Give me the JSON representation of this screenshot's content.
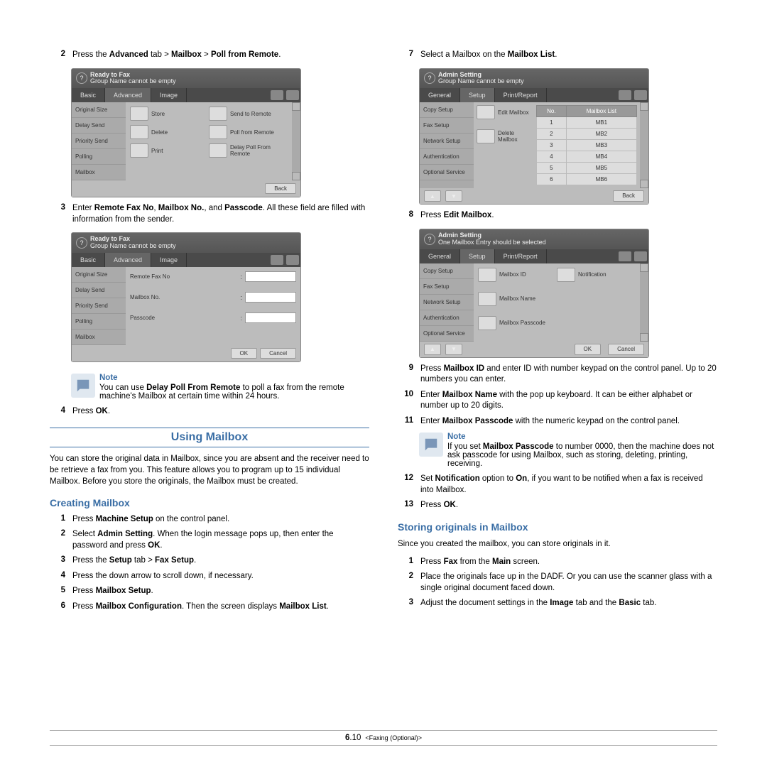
{
  "footer": {
    "pageChap": "6",
    "pageNum": ".10",
    "title": "<Faxing (Optional)>"
  },
  "left": {
    "s2": {
      "pre": "Press the ",
      "b1": "Advanced",
      "mid": " tab > ",
      "b2": "Mailbox",
      "mid2": " > ",
      "b3": "Poll from Remote",
      "end": "."
    },
    "ui1": {
      "hdr_b": "Ready to Fax",
      "hdr_s": "Group Name cannot be empty",
      "tabs": [
        "Basic",
        "Advanced",
        "Image"
      ],
      "side": [
        "Original Size",
        "Delay Send",
        "Priority Send",
        "Polling",
        "Mailbox"
      ],
      "rows": [
        [
          "Store",
          "Send to Remote"
        ],
        [
          "Delete",
          "Poll from Remote"
        ],
        [
          "Print",
          "Delay Poll From Remote"
        ]
      ],
      "back": "Back"
    },
    "s3": {
      "pre": "Enter ",
      "b1": "Remote Fax No",
      "c1": ", ",
      "b2": "Mailbox No.",
      "c2": ", and ",
      "b3": "Passcode",
      "end": ". All these field are filled with information from the sender."
    },
    "ui2": {
      "hdr_b": "Ready to Fax",
      "hdr_s": "Group Name cannot be empty",
      "tabs": [
        "Basic",
        "Advanced",
        "Image"
      ],
      "side": [
        "Original Size",
        "Delay Send",
        "Priority Send",
        "Polling",
        "Mailbox"
      ],
      "fields": [
        "Remote Fax No",
        "Mailbox No.",
        "Passcode"
      ],
      "ok": "OK",
      "cancel": "Cancel"
    },
    "note1": {
      "h": "Note",
      "t1": "You can use ",
      "b": "Delay Poll From Remote",
      "t2": " to poll a fax from the remote machine's Mailbox at certain time within 24 hours."
    },
    "s4": {
      "pre": "Press ",
      "b": "OK",
      "end": "."
    },
    "mainTitle": "Using Mailbox",
    "mainPara": "You can store the original data in Mailbox, since you are absent and the receiver need to be retrieve a fax from you. This feature allows you to program up to 15 individual Mailbox. Before you store the originals, the Mailbox must be created.",
    "subTitle": "Creating Mailbox",
    "c1": {
      "pre": "Press ",
      "b": "Machine Setup",
      "end": " on the control panel."
    },
    "c2": {
      "pre": "Select ",
      "b": "Admin Setting",
      "end": ". When the login message pops up, then enter the password and press ",
      "b2": "OK",
      "end2": "."
    },
    "c3": {
      "pre": "Press the ",
      "b": "Setup",
      "mid": " tab > ",
      "b2": "Fax Setup",
      "end": "."
    },
    "c4": "Press the down arrow to scroll down, if necessary.",
    "c5": {
      "pre": "Press ",
      "b": "Mailbox Setup",
      "end": "."
    },
    "c6": {
      "pre": "Press ",
      "b": "Mailbox Configuration",
      "mid": ". Then the screen displays ",
      "b2": "Mailbox List",
      "end": "."
    }
  },
  "right": {
    "s7": {
      "pre": "Select a Mailbox on the ",
      "b": "Mailbox List",
      "end": "."
    },
    "ui3": {
      "hdr_b": "Admin Setting",
      "hdr_s": "Group Name cannot be empty",
      "tabs": [
        "General",
        "Setup",
        "Print/Report"
      ],
      "side": [
        "Copy Setup",
        "Fax Setup",
        "Network Setup",
        "Authentication",
        "Optional Service"
      ],
      "mid": [
        "Edit Mailbox",
        "Delete Mailbox"
      ],
      "th": [
        "No.",
        "Mailbox List"
      ],
      "rows": [
        [
          "1",
          "MB1"
        ],
        [
          "2",
          "MB2"
        ],
        [
          "3",
          "MB3"
        ],
        [
          "4",
          "MB4"
        ],
        [
          "5",
          "MB5"
        ],
        [
          "6",
          "MB6"
        ]
      ],
      "back": "Back"
    },
    "s8": {
      "pre": "Press ",
      "b": "Edit Mailbox",
      "end": "."
    },
    "ui4": {
      "hdr_b": "Admin Setting",
      "hdr_s": "One Mailbox Entry should be selected",
      "tabs": [
        "General",
        "Setup",
        "Print/Report"
      ],
      "side": [
        "Copy Setup",
        "Fax Setup",
        "Network Setup",
        "Authentication",
        "Optional Service"
      ],
      "fields": [
        [
          "Mailbox ID",
          "Notification"
        ],
        [
          "Mailbox Name",
          ""
        ],
        [
          "Mailbox Passcode",
          ""
        ]
      ],
      "ok": "OK",
      "cancel": "Cancel"
    },
    "s9": {
      "pre": "Press ",
      "b": "Mailbox ID",
      "end": " and enter ID with number keypad on the control panel. Up to 20 numbers you can enter."
    },
    "s10": {
      "pre": "Enter ",
      "b": "Mailbox Name",
      "end": " with the pop up keyboard. It can be either alphabet or number up to 20 digits."
    },
    "s11": {
      "pre": "Enter ",
      "b": "Mailbox Passcode",
      "end": " with the numeric keypad on the control panel."
    },
    "note2": {
      "h": "Note",
      "t1": "If you set ",
      "b": "Mailbox Passcode",
      "t2": " to number 0000, then the machine does not ask passcode for using Mailbox, such as storing, deleting, printing, receiving."
    },
    "s12": {
      "pre": "Set ",
      "b": "Notification",
      "mid": " option to ",
      "b2": "On",
      "end": ", if you want to be notified when a fax is received into Mailbox."
    },
    "s13": {
      "pre": "Press ",
      "b": "OK",
      "end": "."
    },
    "subTitle": "Storing originals in Mailbox",
    "para": "Since you created the mailbox, you can store originals in it.",
    "o1": {
      "pre": "Press ",
      "b": "Fax",
      "mid": " from the ",
      "b2": "Main",
      "end": " screen."
    },
    "o2": "Place the originals face up in the DADF. Or you can use the scanner glass with a single original document faced down.",
    "o3": {
      "pre": "Adjust the document settings in the ",
      "b": "Image",
      "mid": " tab and the ",
      "b2": "Basic",
      "end": " tab."
    }
  }
}
